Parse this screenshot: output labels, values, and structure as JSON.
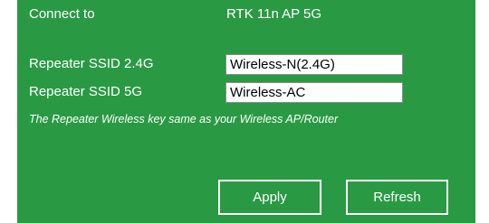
{
  "connect": {
    "label": "Connect to",
    "value": "RTK 11n AP 5G"
  },
  "ssid24": {
    "label": "Repeater SSID 2.4G",
    "value": "Wireless-N(2.4G)"
  },
  "ssid5": {
    "label": "Repeater SSID 5G",
    "value": "Wireless-AC"
  },
  "note": "The Repeater Wireless key same as your Wireless AP/Router",
  "buttons": {
    "apply": "Apply",
    "refresh": "Refresh"
  },
  "colors": {
    "panel_background": "#2a9944",
    "text": "#ffffff"
  }
}
